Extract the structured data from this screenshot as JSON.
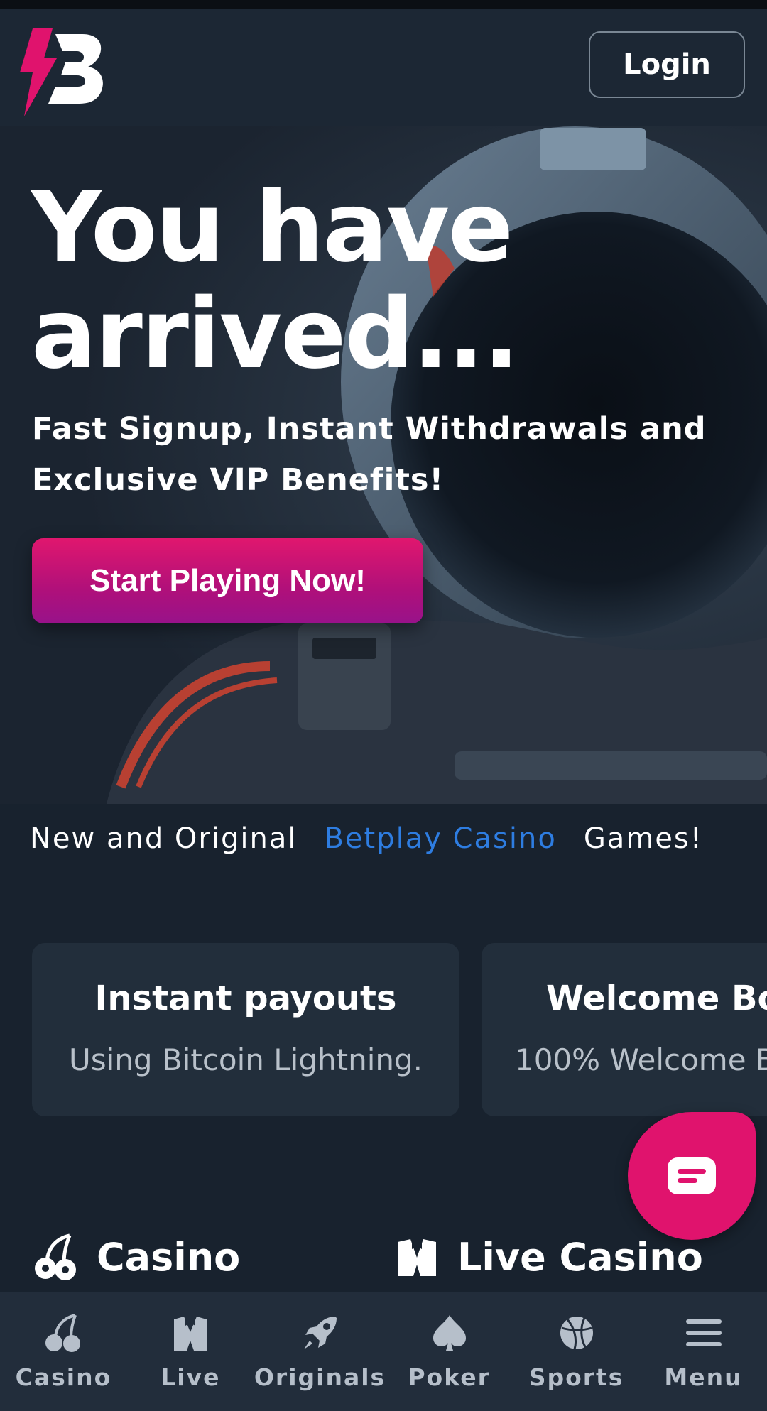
{
  "header": {
    "logo_alt": "B",
    "login_label": "Login"
  },
  "hero": {
    "title": "You have arrived...",
    "subtitle": "Fast Signup, Instant Withdrawals and Exclusive VIP Benefits!",
    "cta_label": "Start Playing Now!"
  },
  "ticker": {
    "part1": "New and Original",
    "part2": "Betplay Casino",
    "part3": "Games!"
  },
  "cards": [
    {
      "title": "Instant payouts",
      "subtitle": "Using Bitcoin Lightning."
    },
    {
      "title": "Welcome Bo",
      "subtitle": "100% Welcome B"
    }
  ],
  "sections": {
    "casino": "Casino",
    "live_casino": "Live Casino"
  },
  "bottom_nav": [
    {
      "label": "Casino",
      "icon": "cherries-icon"
    },
    {
      "label": "Live",
      "icon": "tuxedo-icon"
    },
    {
      "label": "Originals",
      "icon": "rocket-icon"
    },
    {
      "label": "Poker",
      "icon": "spade-icon"
    },
    {
      "label": "Sports",
      "icon": "ball-icon"
    },
    {
      "label": "Menu",
      "icon": "hamburger-icon"
    }
  ],
  "colors": {
    "brand_pink": "#e0136d",
    "accent_blue": "#2e7de1",
    "background": "#18222e"
  }
}
